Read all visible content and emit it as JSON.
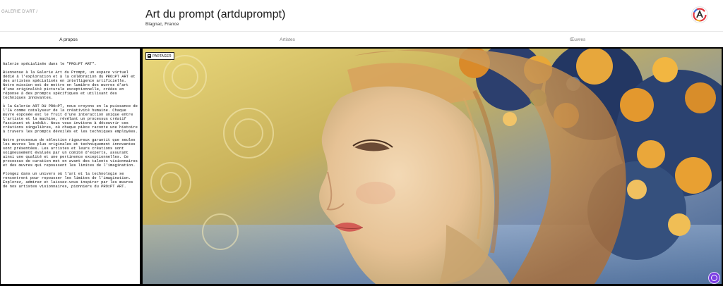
{
  "header": {
    "breadcrumb": "GALERIE D'ART /",
    "title": "Art du prompt (artduprompt)",
    "location": "Blagnac, France",
    "logo_icon": "gallery-logo-icon"
  },
  "tabs": [
    {
      "label": "A propos",
      "active": true
    },
    {
      "label": "Artistes",
      "active": false
    },
    {
      "label": "Œuvres",
      "active": false
    }
  ],
  "about": {
    "paragraphs": [
      "Galerie spécialisée dans le \"PRO☐PT ART\".",
      "Bienvenue à la Galerie Art du Prompt, un espace virtuel dédié à l'exploration et à la célébration du PRO☐PT ART et des artistes spécialisés en intelligence artificielle. Notre mission est de mettre en lumière des œuvres d'art d'une originalité picturale exceptionnelle, créées en réponse à des prompts spécifiques et utilisant des techniques innovantes.",
      "À la Galerie ART DU PRO☐PT, nous croyons en la puissance de l'IA comme catalyseur de la créativité humaine. Chaque œuvre exposée est le fruit d'une interaction unique entre l'artiste et la machine, révélant un processus créatif fascinant et inédit. Nous vous invitons à découvrir ces créations singulières, où chaque pièce raconte une histoire à travers les prompts dévoilés et les techniques employées.",
      "Notre processus de sélection rigoureux garantit que seules les œuvres les plus originales et techniquement innovantes sont présentées. Les artistes et leurs créations sont soigneusement évalués par un comité d'experts, assurant ainsi une qualité et une pertinence exceptionnelles. Ce processus de curation met en avant des talents visionnaires et des œuvres qui repoussent les limites de l'imagination.",
      "Plongez dans un univers où l'art et la technologie se rencontrent pour repousser les limites de l'imagination. Explorez, admirez et laissez-vous inspirer par les œuvres de nos artistes visionnaires, pionniers du PRO☐PT ART."
    ]
  },
  "artwork": {
    "share_label": "PARTAGER",
    "share_icon": "share-icon",
    "fab_icon": "assistant-icon",
    "colors": {
      "accent": "#7b3fe4",
      "frame": "#000000"
    }
  }
}
